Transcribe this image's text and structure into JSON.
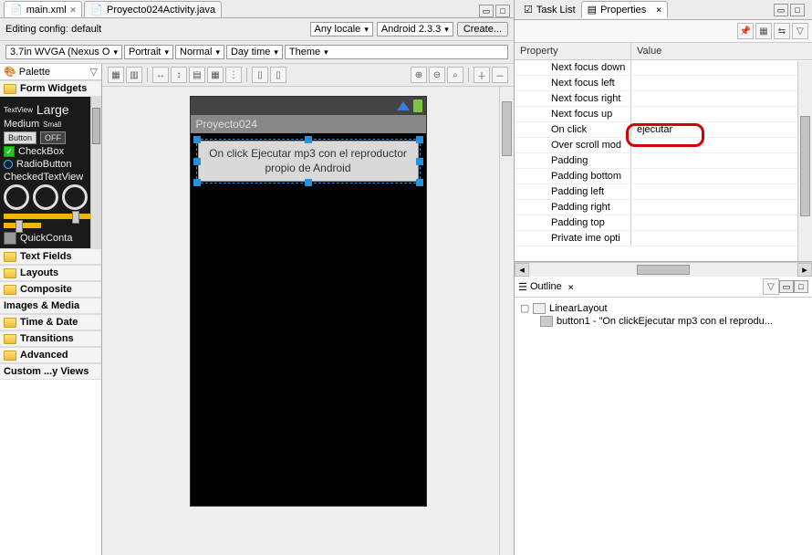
{
  "editorTabs": [
    {
      "label": "main.xml",
      "active": true
    },
    {
      "label": "Proyecto024Activity.java",
      "active": false
    }
  ],
  "configRow": {
    "editingLabel": "Editing config:  default",
    "localeDropdown": "Any locale",
    "androidDropdown": "Android 2.3.3",
    "createBtn": "Create..."
  },
  "deviceRow": {
    "device": "3.7in WVGA (Nexus O",
    "orient": "Portrait",
    "mode": "Normal",
    "time": "Day time",
    "theme": "Theme"
  },
  "palette": {
    "title": "Palette",
    "cats": [
      "Form Widgets",
      "Text Fields",
      "Layouts",
      "Composite",
      "Images & Media",
      "Time & Date",
      "Transitions",
      "Advanced",
      "Custom ...y Views"
    ],
    "fw": {
      "textview": "TextView",
      "large": "Large",
      "medium": "Medium",
      "small": "Small",
      "button": "Button",
      "off": "OFF",
      "checkbox": "CheckBox",
      "radio": "RadioButton",
      "checkedtv": "CheckedTextView",
      "quick": "QuickConta"
    }
  },
  "phone": {
    "title": "Proyecto024",
    "buttonText": "On click  Ejecutar mp3 con el reproductor propio de Android"
  },
  "rightTabs": {
    "task": "Task List",
    "props": "Properties"
  },
  "propsHeader": {
    "c1": "Property",
    "c2": "Value"
  },
  "properties": [
    {
      "name": "Next focus down",
      "value": ""
    },
    {
      "name": "Next focus left",
      "value": ""
    },
    {
      "name": "Next focus right",
      "value": ""
    },
    {
      "name": "Next focus up",
      "value": ""
    },
    {
      "name": "On click",
      "value": "ejecutar"
    },
    {
      "name": "Over scroll mod",
      "value": ""
    },
    {
      "name": "Padding",
      "value": ""
    },
    {
      "name": "Padding bottom",
      "value": ""
    },
    {
      "name": "Padding left",
      "value": ""
    },
    {
      "name": "Padding right",
      "value": ""
    },
    {
      "name": "Padding top",
      "value": ""
    },
    {
      "name": "Private ime opti",
      "value": ""
    }
  ],
  "outline": {
    "title": "Outline",
    "root": "LinearLayout",
    "child": "button1 - \"On clickEjecutar mp3 con el reprodu..."
  }
}
